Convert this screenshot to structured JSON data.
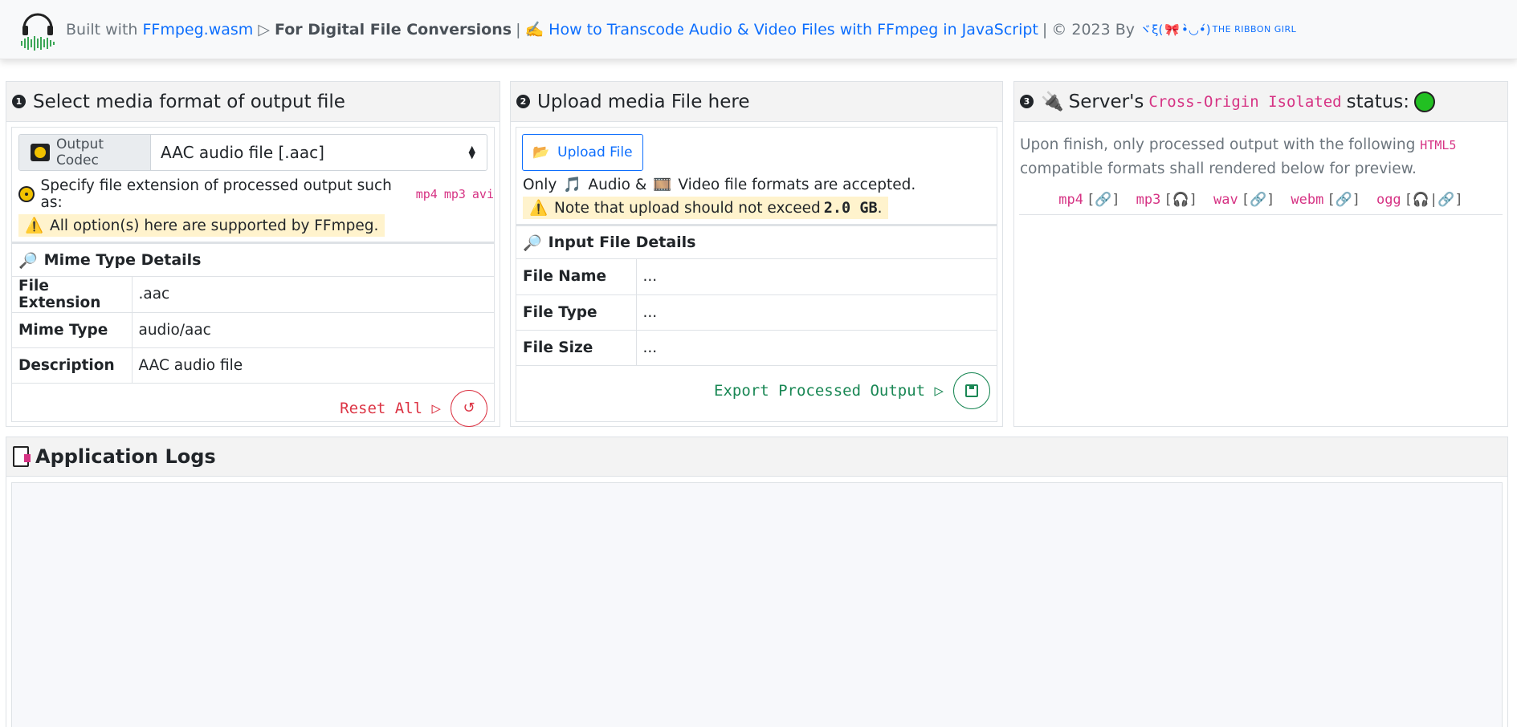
{
  "header": {
    "built_with": "Built with",
    "ffmpeg_link": "FFmpeg.wasm",
    "arrow": "▷",
    "tagline": "For Digital File Conversions",
    "pipe": "|",
    "article_link": "How to Transcode Audio & Video Files with FFmpeg in JavaScript",
    "copyright": "© 2023 By",
    "author_pre": "ヾξ(",
    "author_post": "•̀◡•́)",
    "author_name": "THE RIBBON GIRL"
  },
  "panel1": {
    "num": "1",
    "title": "Select media format of output file",
    "codec_label": "Output Codec",
    "selected_codec": "AAC audio file [.aac]",
    "hint": "Specify file extension of processed output such as:",
    "ext_examples": [
      "mp4",
      "mp3",
      "avi"
    ],
    "support_note": "All option(s) here are supported by FFmpeg.",
    "details_title": "Mime Type Details",
    "rows": [
      {
        "key": "File Extension",
        "value": ".aac"
      },
      {
        "key": "Mime Type",
        "value": "audio/aac"
      },
      {
        "key": "Description",
        "value": "AAC audio file"
      }
    ],
    "reset_label": "Reset All ▷",
    "reset_color": "#dc3545"
  },
  "panel2": {
    "num": "2",
    "title": "Upload media File here",
    "upload_label": "Upload File",
    "only": "Only",
    "audio_label": "Audio &",
    "video_label": "Video file formats are accepted.",
    "limit_pre": "Note that upload should not exceed",
    "limit_value": "2.0 GB",
    "limit_post": ".",
    "details_title": "Input File Details",
    "rows": [
      {
        "key": "File Name",
        "value": "..."
      },
      {
        "key": "File Type",
        "value": "..."
      },
      {
        "key": "File Size",
        "value": "..."
      }
    ],
    "export_label": "Export Processed Output ▷",
    "export_color": "#198754"
  },
  "panel3": {
    "num": "3",
    "title_pre": "Server's",
    "title_code": "Cross-Origin Isolated",
    "title_post": "status:",
    "status_color": "#22c022",
    "desc_pre": "Upon finish, only processed output with the following",
    "desc_code": "HTML5",
    "desc_post": "compatible formats shall rendered below for preview.",
    "formats": [
      {
        "name": "mp4",
        "icons": "[🔗]"
      },
      {
        "name": "mp3",
        "icons": "[🎧]"
      },
      {
        "name": "wav",
        "icons": "[🔗]"
      },
      {
        "name": "webm",
        "icons": "[🔗]"
      },
      {
        "name": "ogg",
        "icons": "[🎧|🔗]"
      }
    ]
  },
  "logs": {
    "title": "Application Logs"
  }
}
